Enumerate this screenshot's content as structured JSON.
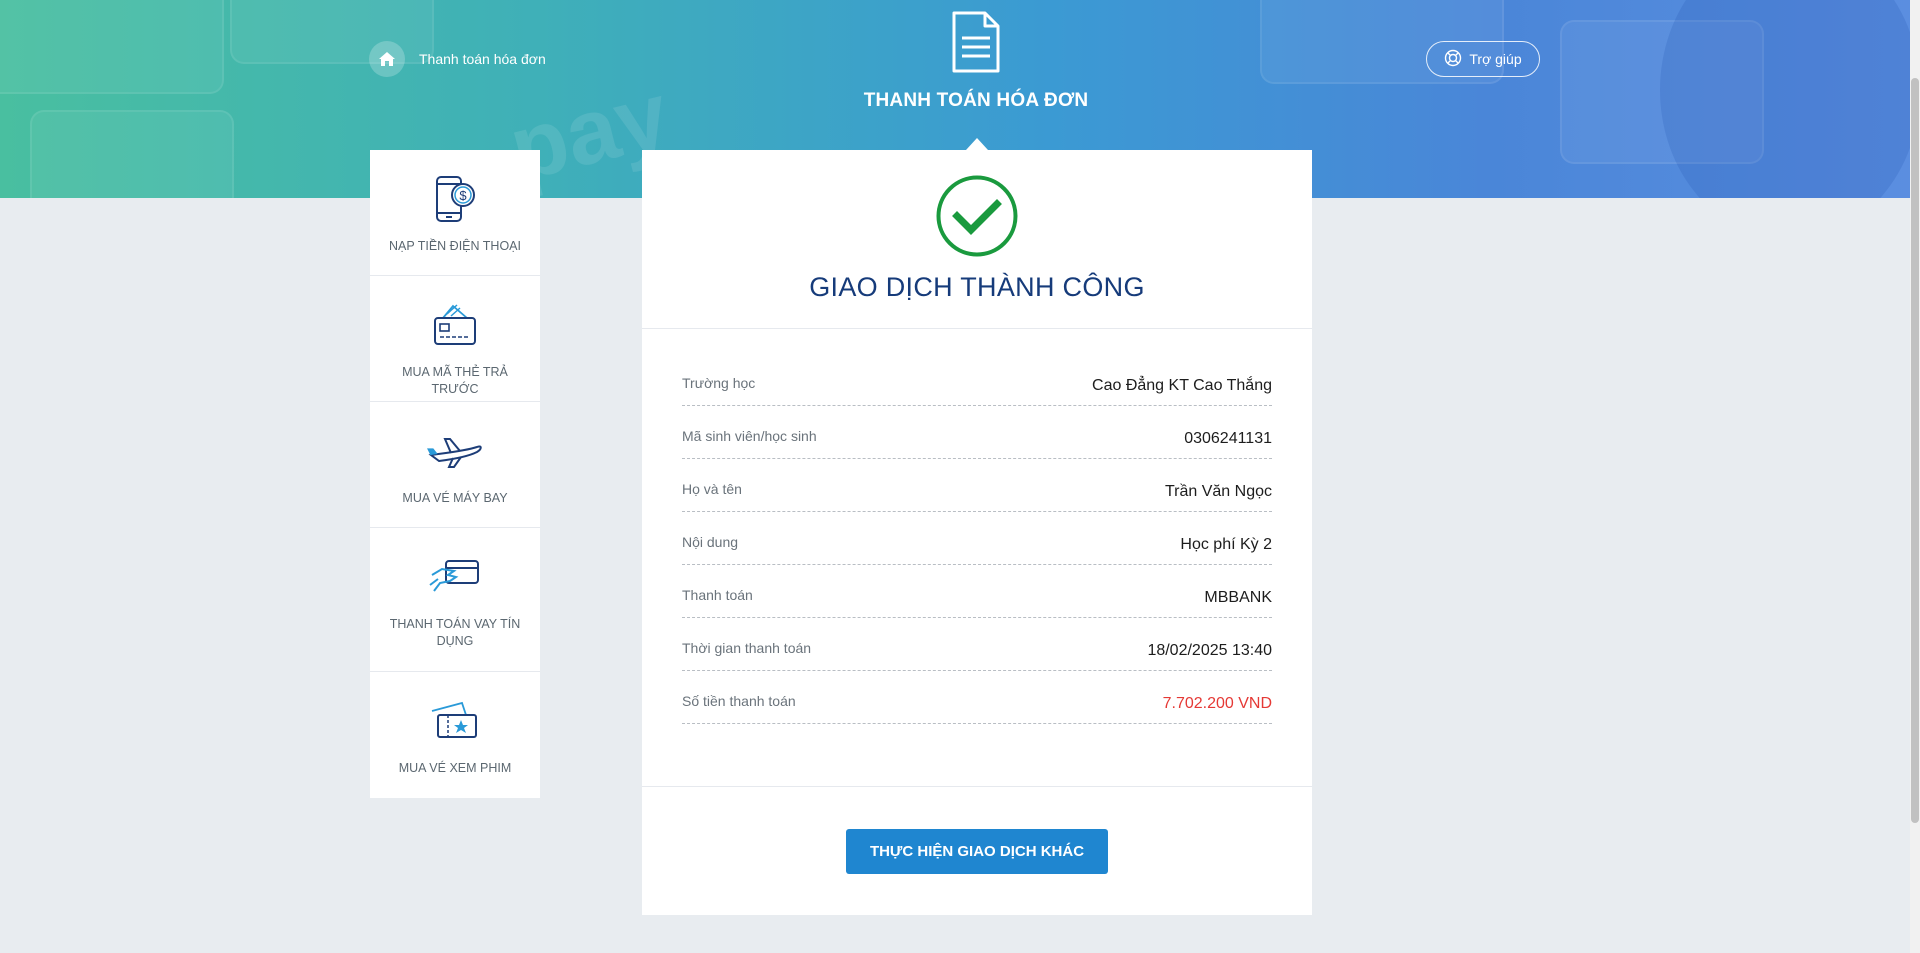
{
  "header": {
    "breadcrumb_label": "Thanh toán hóa đơn",
    "title": "THANH TOÁN HÓA ĐƠN",
    "help_label": "Trợ giúp",
    "banner_word": "pay"
  },
  "sidebar": {
    "items": [
      {
        "label": "NẠP TIỀN ĐIỆN THOẠI",
        "icon": "phone-dollar-icon"
      },
      {
        "label": "MUA MÃ THẺ TRẢ TRƯỚC",
        "icon": "prepaid-card-icon"
      },
      {
        "label": "MUA VÉ MÁY BAY",
        "icon": "airplane-icon"
      },
      {
        "label": "THANH TOÁN VAY TÍN DỤNG",
        "icon": "credit-card-hand-icon"
      },
      {
        "label": "MUA VÉ XEM PHIM",
        "icon": "movie-ticket-icon"
      }
    ]
  },
  "result": {
    "title": "GIAO DỊCH THÀNH CÔNG",
    "icon": "check-circle-icon"
  },
  "details": [
    {
      "label": "Trường học",
      "value": "Cao Đẳng KT Cao Thắng"
    },
    {
      "label": "Mã sinh viên/học sinh",
      "value": "0306241131"
    },
    {
      "label": "Họ và tên",
      "value": "Trần Văn Ngọc"
    },
    {
      "label": "Nội dung",
      "value": "Học phí Kỳ 2"
    },
    {
      "label": "Thanh toán",
      "value": "MBBANK"
    },
    {
      "label": "Thời gian thanh toán",
      "value": "18/02/2025 13:40"
    },
    {
      "label": "Số tiền thanh toán",
      "value": "7.702.200 VND"
    }
  ],
  "action": {
    "button_label": "THỰC HIỆN GIAO DỊCH KHÁC"
  },
  "colors": {
    "primary_blue": "#1f86d0",
    "title_navy": "#163b7a",
    "success_green": "#1a9a3e",
    "amount_red": "#e53935"
  }
}
